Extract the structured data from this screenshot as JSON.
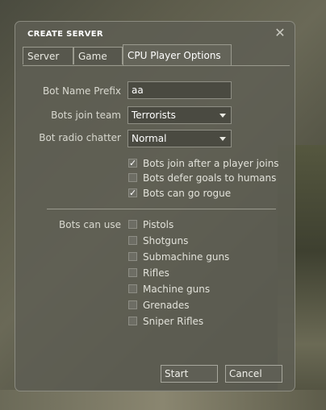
{
  "dialog": {
    "title": "CREATE SERVER",
    "close_icon": "close-icon"
  },
  "tabs": [
    {
      "label": "Server",
      "active": false
    },
    {
      "label": "Game",
      "active": false
    },
    {
      "label": "CPU Player Options",
      "active": true
    }
  ],
  "fields": {
    "bot_name_prefix": {
      "label": "Bot Name Prefix",
      "value": "aa"
    },
    "bots_join_team": {
      "label": "Bots join team",
      "value": "Terrorists"
    },
    "bot_radio_chatter": {
      "label": "Bot radio chatter",
      "value": "Normal"
    }
  },
  "behavior_checks": [
    {
      "label": "Bots join after a player joins",
      "checked": true,
      "mark": "✓"
    },
    {
      "label": "Bots defer goals to humans",
      "checked": false,
      "mark": ""
    },
    {
      "label": "Bots can go rogue",
      "checked": true,
      "mark": "✓"
    }
  ],
  "weapons": {
    "label": "Bots can use",
    "items": [
      {
        "label": "Pistols",
        "checked": false
      },
      {
        "label": "Shotguns",
        "checked": false
      },
      {
        "label": "Submachine guns",
        "checked": false
      },
      {
        "label": "Rifles",
        "checked": false
      },
      {
        "label": "Machine guns",
        "checked": false
      },
      {
        "label": "Grenades",
        "checked": false
      },
      {
        "label": "Sniper Rifles",
        "checked": false
      }
    ]
  },
  "buttons": {
    "start": "Start",
    "cancel": "Cancel"
  },
  "colors": {
    "dialog_bg": "#5e5e54",
    "text": "#e2e2da",
    "border": "#9a9a8e"
  }
}
